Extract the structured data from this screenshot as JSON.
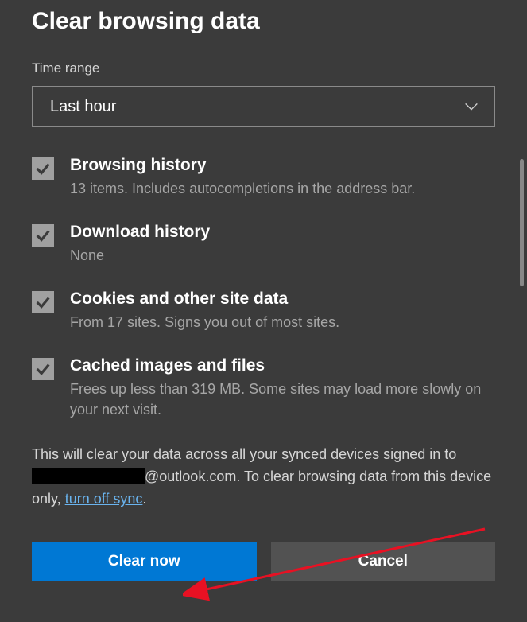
{
  "title": "Clear browsing data",
  "timeRange": {
    "label": "Time range",
    "value": "Last hour"
  },
  "options": [
    {
      "title": "Browsing history",
      "desc": "13 items. Includes autocompletions in the address bar."
    },
    {
      "title": "Download history",
      "desc": "None"
    },
    {
      "title": "Cookies and other site data",
      "desc": "From 17 sites. Signs you out of most sites."
    },
    {
      "title": "Cached images and files",
      "desc": "Frees up less than 319 MB. Some sites may load more slowly on your next visit."
    }
  ],
  "info": {
    "part1": "This will clear your data across all your synced devices signed in to ",
    "email": "@outlook.com",
    "part2": ". To clear browsing data from this device only, ",
    "link": "turn off sync",
    "part3": "."
  },
  "buttons": {
    "primary": "Clear now",
    "secondary": "Cancel"
  }
}
